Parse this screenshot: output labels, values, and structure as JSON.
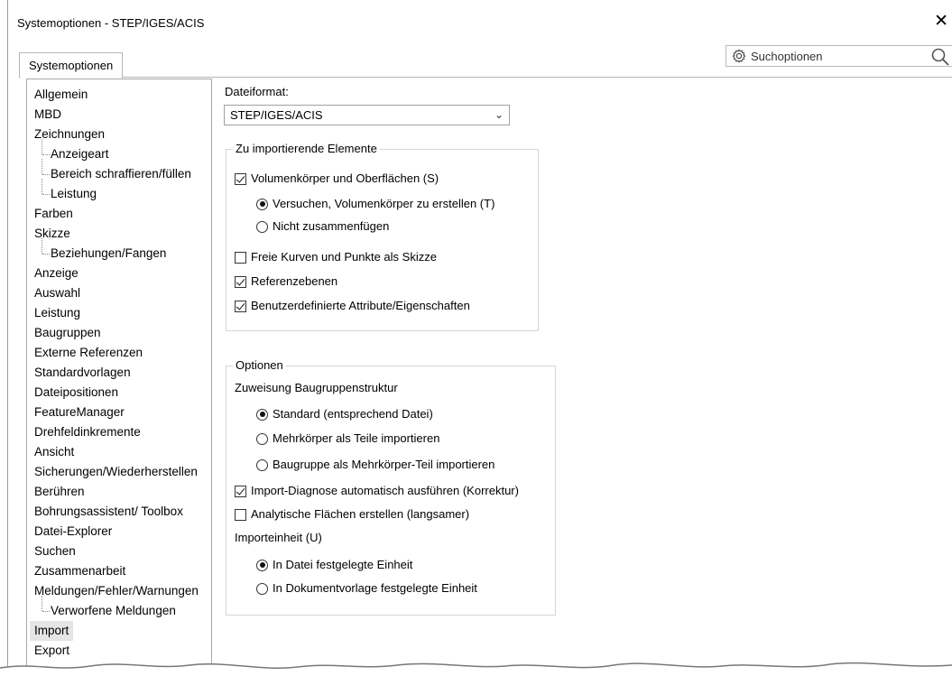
{
  "window": {
    "title": "Systemoptionen - STEP/IGES/ACIS",
    "close_glyph": "✕"
  },
  "tabs": [
    {
      "label": "Systemoptionen"
    }
  ],
  "search": {
    "placeholder": "Suchoptionen",
    "icon": "gear-icon",
    "search_icon": "magnifier-icon"
  },
  "sidebar": {
    "items": [
      {
        "label": "Allgemein",
        "level": 0
      },
      {
        "label": "MBD",
        "level": 0
      },
      {
        "label": "Zeichnungen",
        "level": 0
      },
      {
        "label": "Anzeigeart",
        "level": 1
      },
      {
        "label": "Bereich schraffieren/füllen",
        "level": 1
      },
      {
        "label": "Leistung",
        "level": 1
      },
      {
        "label": "Farben",
        "level": 0
      },
      {
        "label": "Skizze",
        "level": 0
      },
      {
        "label": "Beziehungen/Fangen",
        "level": 1
      },
      {
        "label": "Anzeige",
        "level": 0
      },
      {
        "label": "Auswahl",
        "level": 0
      },
      {
        "label": "Leistung",
        "level": 0
      },
      {
        "label": "Baugruppen",
        "level": 0
      },
      {
        "label": "Externe Referenzen",
        "level": 0
      },
      {
        "label": "Standardvorlagen",
        "level": 0
      },
      {
        "label": "Dateipositionen",
        "level": 0
      },
      {
        "label": "FeatureManager",
        "level": 0
      },
      {
        "label": "Drehfeldinkremente",
        "level": 0
      },
      {
        "label": "Ansicht",
        "level": 0
      },
      {
        "label": "Sicherungen/Wiederherstellen",
        "level": 0
      },
      {
        "label": "Berühren",
        "level": 0
      },
      {
        "label": "Bohrungsassistent/ Toolbox",
        "level": 0
      },
      {
        "label": "Datei-Explorer",
        "level": 0
      },
      {
        "label": "Suchen",
        "level": 0
      },
      {
        "label": "Zusammenarbeit",
        "level": 0
      },
      {
        "label": "Meldungen/Fehler/Warnungen",
        "level": 0
      },
      {
        "label": "Verworfene Meldungen",
        "level": 1
      },
      {
        "label": "Import",
        "level": 0,
        "selected": true
      },
      {
        "label": "Export",
        "level": 0
      }
    ]
  },
  "main": {
    "dateiformat_label": "Dateiformat:",
    "dateiformat_value": "STEP/IGES/ACIS",
    "import_group": {
      "legend": "Zu importierende Elemente",
      "volumen": {
        "label": "Volumenkörper und Oberflächen (S)",
        "checked": true
      },
      "versuchen": {
        "label": "Versuchen, Volumenkörper zu erstellen (T)",
        "checked": true
      },
      "nicht_zusammen": {
        "label": "Nicht zusammenfügen",
        "checked": false
      },
      "freie_kurven": {
        "label": "Freie Kurven und Punkte als Skizze",
        "checked": false
      },
      "referenzebenen": {
        "label": "Referenzebenen",
        "checked": true
      },
      "benutzerdef": {
        "label": "Benutzerdefinierte Attribute/Eigenschaften",
        "checked": true
      }
    },
    "options_group": {
      "legend": "Optionen",
      "zuweisung_label": "Zuweisung Baugruppenstruktur",
      "standard": {
        "label": "Standard (entsprechend Datei)",
        "checked": true
      },
      "mehrkoerper": {
        "label": "Mehrkörper als Teile importieren",
        "checked": false
      },
      "baugruppe": {
        "label": "Baugruppe als Mehrkörper-Teil importieren",
        "checked": false
      },
      "import_diag": {
        "label": "Import-Diagnose automatisch ausführen (Korrektur)",
        "checked": true
      },
      "analytisch": {
        "label": "Analytische Flächen erstellen (langsamer)",
        "checked": false
      },
      "importeinheit_label": "Importeinheit (U)",
      "in_datei": {
        "label": "In Datei festgelegte Einheit",
        "checked": true
      },
      "in_dokument": {
        "label": "In Dokumentvorlage festgelegte Einheit",
        "checked": false
      }
    }
  }
}
